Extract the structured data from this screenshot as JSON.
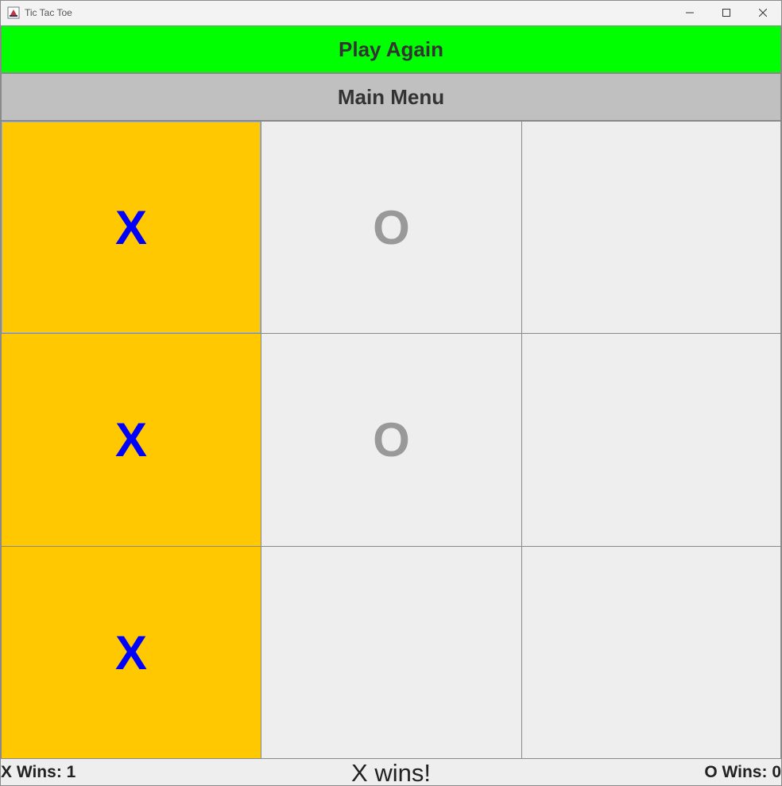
{
  "window": {
    "title": "Tic Tac Toe",
    "controls": [
      "minimize-icon",
      "maximize-icon",
      "close-icon"
    ]
  },
  "buttons": {
    "play_again": "Play Again",
    "main_menu": "Main Menu"
  },
  "board": {
    "cells": [
      {
        "mark": "X",
        "highlight": true
      },
      {
        "mark": "O",
        "highlight": false
      },
      {
        "mark": "",
        "highlight": false
      },
      {
        "mark": "X",
        "highlight": true
      },
      {
        "mark": "O",
        "highlight": false
      },
      {
        "mark": "",
        "highlight": false
      },
      {
        "mark": "X",
        "highlight": true
      },
      {
        "mark": "",
        "highlight": false
      },
      {
        "mark": "",
        "highlight": false
      }
    ]
  },
  "status": {
    "x_wins": "X Wins: 1",
    "winner": "X wins!",
    "o_wins": "O Wins: 0"
  },
  "colors": {
    "play_again_bg": "#00ff00",
    "main_menu_bg": "#c0c0c0",
    "win_cell_bg": "#ffc800",
    "cell_bg": "#eeeeee",
    "x_color": "#0000ff",
    "o_color": "#999999"
  }
}
